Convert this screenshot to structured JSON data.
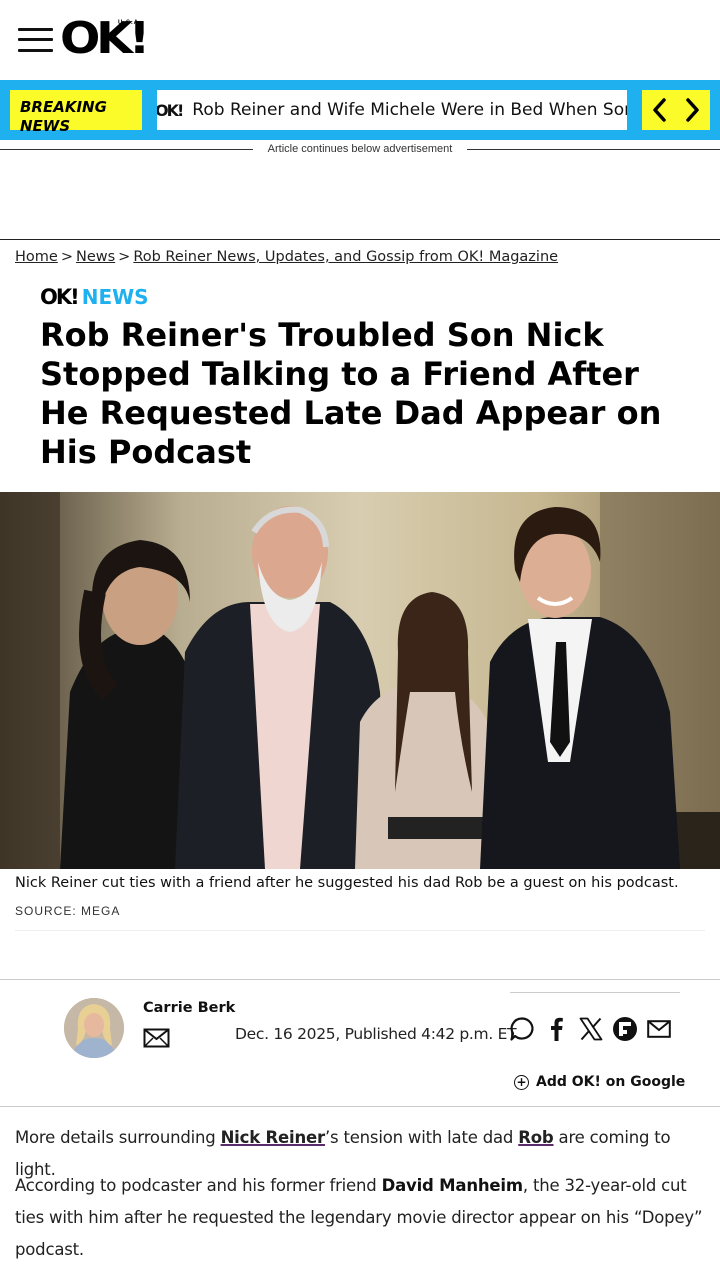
{
  "header": {
    "logo": "OK!",
    "logo_sub": "U.S.A."
  },
  "breaking": {
    "label": "BREAKING NEWS",
    "ticker_logo": "OK!",
    "ticker_text": "Rob Reiner and Wife Michele Were in Bed When Son Nick"
  },
  "ad_notice": "Article continues below advertisement",
  "breadcrumb": {
    "home": "Home",
    "news": "News",
    "section": "Rob Reiner News, Updates, and Gossip from OK! Magazine",
    "separator": ">"
  },
  "category": {
    "logo": "OK!",
    "label": "NEWS"
  },
  "headline": "Rob Reiner's Troubled Son Nick Stopped Talking to a Friend After He Requested Late Dad Appear on His Podcast",
  "hero": {
    "caption": "Nick Reiner cut ties with a friend after he suggested his dad Rob be a guest on his podcast.",
    "source": "SOURCE: MEGA"
  },
  "byline": {
    "author": "Carrie Berk",
    "date": "Dec. 16 2025, Published 4:42 p.m. ET",
    "google_button": "Add OK! on Google"
  },
  "share_icons": [
    "comment-icon",
    "facebook-icon",
    "x-icon",
    "flipboard-icon",
    "email-icon"
  ],
  "article": {
    "p1_before": "More details surrounding ",
    "p1_link1": "Nick Reiner",
    "p1_middle": "’s tension with late dad ",
    "p1_link2": "Rob",
    "p1_after": " are coming to light.",
    "p2_before": "According to podcaster and his former friend ",
    "p2_bold": "David Manheim",
    "p2_after": ", the 32-year-old cut ties with him after he requested the legendary movie director appear on his “Dopey” podcast."
  },
  "colors": {
    "accent_blue": "#1fb0ef",
    "breaking_yellow": "#fbfb2a",
    "link_underline": "#5a2b6b"
  }
}
